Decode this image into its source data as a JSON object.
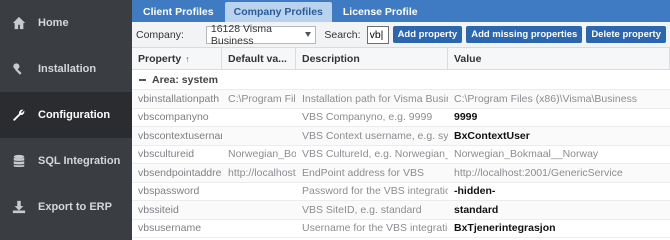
{
  "sidebar": {
    "items": [
      {
        "label": "Home",
        "icon": "home-icon"
      },
      {
        "label": "Installation",
        "icon": "wrench-key-icon"
      },
      {
        "label": "Configuration",
        "icon": "wrench-icon",
        "active": true
      },
      {
        "label": "SQL Integration",
        "icon": "database-icon"
      },
      {
        "label": "Export to ERP",
        "icon": "download-icon"
      }
    ]
  },
  "tabs": [
    {
      "label": "Client Profiles"
    },
    {
      "label": "Company Profiles",
      "active": true
    },
    {
      "label": "License Profile"
    }
  ],
  "toolbar": {
    "company_label": "Company:",
    "company_value": "16128 Visma Business",
    "search_label": "Search:",
    "search_value": "vb|",
    "add_property": "Add property",
    "add_missing": "Add missing properties",
    "delete_property": "Delete property"
  },
  "grid": {
    "headers": {
      "property": "Property",
      "default_value": "Default va...",
      "description": "Description",
      "value": "Value"
    },
    "group": "Area: system",
    "rows": [
      {
        "property": "vbinstallationpath",
        "default": "C:\\Program Fil...",
        "description": "Installation path for Visma Business...",
        "value": "C:\\Program Files (x86)\\Visma\\Business",
        "strong": false
      },
      {
        "property": "vbscompanyno",
        "default": "",
        "description": "VBS Companyno, e.g. 9999",
        "value": "9999",
        "strong": true
      },
      {
        "property": "vbscontextusername",
        "default": "",
        "description": "VBS Context username, e.g. system",
        "value": "BxContextUser",
        "strong": true
      },
      {
        "property": "vbscultureid",
        "default": "Norwegian_Bo...",
        "description": "VBS CultureId, e.g. Norwegian_Bo...",
        "value": "Norwegian_Bokmaal__Norway",
        "strong": false
      },
      {
        "property": "vbsendpointaddress",
        "default": "http://localhost...",
        "description": "EndPoint address for VBS",
        "value": "http://localhost:2001/GenericService",
        "strong": false
      },
      {
        "property": "vbspassword",
        "default": "",
        "description": "Password for the VBS integration ...",
        "value": "-hidden-",
        "strong": true
      },
      {
        "property": "vbssiteid",
        "default": "",
        "description": "VBS SiteID, e.g. standard",
        "value": "standard",
        "strong": true
      },
      {
        "property": "vbsusername",
        "default": "",
        "description": "Username for the VBS integration ...",
        "value": "BxTjenerintegrasjon",
        "strong": true
      }
    ]
  }
}
